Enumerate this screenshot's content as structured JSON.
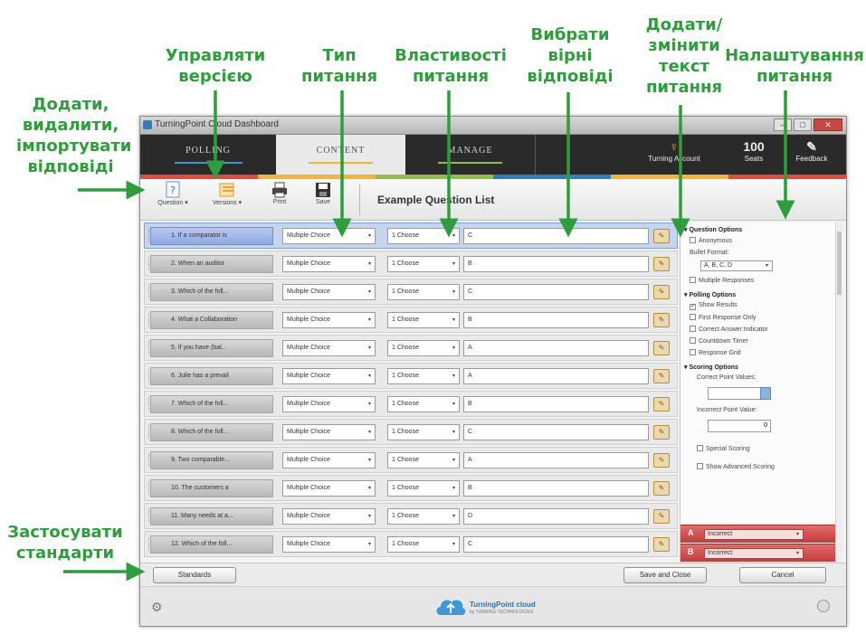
{
  "annotations": {
    "add_answers": "Додати,\nвидалити,\nімпортувати\nвідповіді",
    "manage_version": "Управляти\nверсією",
    "question_type": "Тип\nпитання",
    "question_props": "Властивості\nпитання",
    "choose_correct": "Вибрати\nвірні\nвідповіді",
    "edit_text": "Додати/\nзмінити\nтекст\nпитання",
    "question_settings": "Налаштування\nпитання",
    "apply_standards": "Застосувати\nстандарти"
  },
  "window": {
    "title": "TurningPoint Cloud Dashboard",
    "minimize": "–",
    "maximize": "□",
    "close": "✕"
  },
  "nav": {
    "tabs": [
      "POLLING",
      "CONTENT",
      "MANAGE"
    ],
    "icons": [
      {
        "glyph": "♀",
        "label": "Turning Account"
      },
      {
        "glyph": "100",
        "label": "Seats"
      },
      {
        "glyph": "✎",
        "label": "Feedback"
      }
    ]
  },
  "colors": {
    "accent": "#2e9d3b",
    "strip": [
      "#e8483b",
      "#f2b731",
      "#8fc13e",
      "#2d7fbf",
      "#f2b731",
      "#e8483b"
    ]
  },
  "toolbar": {
    "question_label": "Question",
    "versions_label": "Versions",
    "print_label": "Print",
    "save_label": "Save",
    "list_title": "Example Question List"
  },
  "questions": [
    {
      "text": "1. If a comparator is",
      "type": "Multiple Choice",
      "prop": "1 Choose",
      "answer": "C"
    },
    {
      "text": "2. When an auditor",
      "type": "Multiple Choice",
      "prop": "1 Choose",
      "answer": "B"
    },
    {
      "text": "3. Which of the foll...",
      "type": "Multiple Choice",
      "prop": "1 Choose",
      "answer": "C"
    },
    {
      "text": "4. What a Collaboration",
      "type": "Multiple Choice",
      "prop": "1 Choose",
      "answer": "B"
    },
    {
      "text": "5. If you have (bal...",
      "type": "Multiple Choice",
      "prop": "1 Choose",
      "answer": "A"
    },
    {
      "text": "6. Julie has a prevail",
      "type": "Multiple Choice",
      "prop": "1 Choose",
      "answer": "A"
    },
    {
      "text": "7. Which of the foll...",
      "type": "Multiple Choice",
      "prop": "1 Choose",
      "answer": "B"
    },
    {
      "text": "8. Which of the foll...",
      "type": "Multiple Choice",
      "prop": "1 Choose",
      "answer": "C"
    },
    {
      "text": "9. Two comparable...",
      "type": "Multiple Choice",
      "prop": "1 Choose",
      "answer": "A"
    },
    {
      "text": "10. The customers a",
      "type": "Multiple Choice",
      "prop": "1 Choose",
      "answer": "B"
    },
    {
      "text": "11. Many needs at a...",
      "type": "Multiple Choice",
      "prop": "1 Choose",
      "answer": "D"
    },
    {
      "text": "12. Which of the foll...",
      "type": "Multiple Choice",
      "prop": "1 Choose",
      "answer": "C"
    }
  ],
  "panel": {
    "question_options": "Question Options",
    "anonymous": "Anonymous",
    "bullet_format": "Bullet Format:",
    "bullet_value": "A, B, C, D",
    "multiple_responses": "Multiple Responses",
    "polling_options": "Polling Options",
    "show_results": "Show Results",
    "first_response_only": "First Response Only",
    "correct_answer_indicator": "Correct Answer Indicator",
    "countdown_timer": "Countdown Timer",
    "response_grid": "Response Grid",
    "scoring_options": "Scoring Options",
    "correct_point_values": "Correct Point Values:",
    "incorrect_point_value": "Incorrect Point Value:",
    "incorrect_value": "0",
    "special_scoring": "Special Scoring",
    "show_advanced_scoring": "Show Advanced Scoring",
    "answer_a": "Incorrect",
    "answer_b": "Incorrect"
  },
  "bottom": {
    "standards": "Standards",
    "save_close": "Save and Close",
    "cancel": "Cancel"
  },
  "footer": {
    "logo": "TurningPoint cloud",
    "logo_sub": "by TURNING TECHNOLOGIES"
  }
}
